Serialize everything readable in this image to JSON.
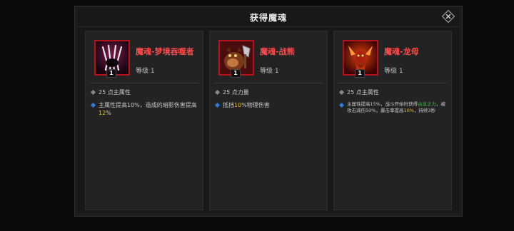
{
  "dialog": {
    "title": "获得魔魂",
    "close_icon": "close-x-diamond-icon"
  },
  "cards": [
    {
      "name": "魔魂-梦境吞噬者",
      "level_label": "等级 1",
      "badge": "1",
      "stat": "25 点主属性",
      "effect_parts": [
        "主属性提高10%，造成的暗影伤害提高",
        "12",
        "%"
      ],
      "portrait_icon": "shadow-claws-portrait-icon"
    },
    {
      "name": "魔魂-战熊",
      "level_label": "等级 1",
      "badge": "1",
      "stat": "25 点力量",
      "effect_parts": [
        "抵挡",
        "10",
        "%物理伤害"
      ],
      "portrait_icon": "war-bear-portrait-icon"
    },
    {
      "name": "魔魂-龙母",
      "level_label": "等级 1",
      "badge": "1",
      "stat": "25 点主属性",
      "effect_parts": [
        "主属性提高15%，战斗开始时获得",
        "古龙之力",
        "，被攻击减伤50%，暴击率提高",
        "10%",
        "，持续3秒"
      ],
      "portrait_icon": "dragon-mother-portrait-icon"
    }
  ],
  "colors": {
    "name_red": "#ff4b4b",
    "highlight_yellow": "#e0c23a",
    "highlight_green": "#45c54a",
    "bullet_blue": "#2a7fe0",
    "frame_red": "#b0131b"
  }
}
